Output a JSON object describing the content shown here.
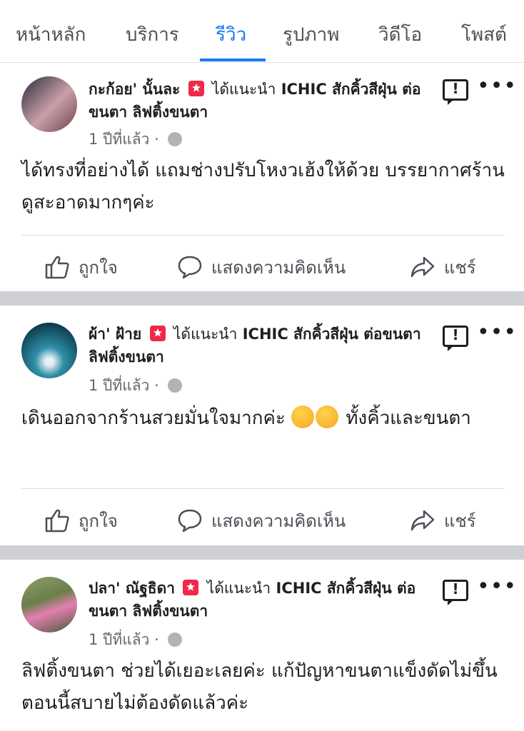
{
  "tabs": [
    "หน้าหลัก",
    "บริการ",
    "รีวิว",
    "รูปภาพ",
    "วิดีโอ",
    "โพสต์"
  ],
  "active_tab": "รีวิว",
  "colors": {
    "accent": "#1877f2",
    "recommend": "#f02849",
    "separator": "#ced0d4",
    "meta": "#65676b"
  },
  "icons": [
    "recommend-icon",
    "globe-icon",
    "report-icon",
    "more-icon",
    "like-icon",
    "comment-icon",
    "share-icon",
    "smile-emoji-icon"
  ],
  "actions": {
    "like": "ถูกใจ",
    "comment": "แสดงความคิดเห็น",
    "share": "แชร์"
  },
  "posts": [
    {
      "author": "กะก้อย' นั้นละ",
      "verb": "ได้แนะนำ",
      "page": "ICHIC สักคิ้วสีฝุ่น ต่อขนตา ลิฟติ้งขนตา",
      "time": "1 ปีที่แล้ว",
      "dot": "·",
      "text": "ได้ทรงที่อย่างได้ แถมช่างปรับโหงวเฮ้งให้ด้วย บรรยากาศร้านดูสะอาดมากๆค่ะ"
    },
    {
      "author": "ผ้า' ฝ้าย",
      "verb": "ได้แนะนำ",
      "page": "ICHIC สักคิ้วสีฝุ่น ต่อขนตา ลิฟติ้งขนตา",
      "time": "1 ปีที่แล้ว",
      "dot": "·",
      "text_before_emoji": "เดินออกจากร้านสวยมั่นใจมากค่ะ",
      "text_after_emoji": "ทั้งคิ้วและขนตา"
    },
    {
      "author": "ปลา' ณัฐธิดา",
      "verb": "ได้แนะนำ",
      "page": "ICHIC สักคิ้วสีฝุ่น ต่อขนตา ลิฟติ้งขนตา",
      "time": "1 ปีที่แล้ว",
      "dot": "·",
      "text": "ลิฟติ้งขนตา ช่วยได้เยอะเลยค่ะ แก้ปัญหาขนตาแข็งดัดไม่ขึ้น ตอนนี้สบายไม่ต้องดัดแล้วค่ะ"
    }
  ]
}
